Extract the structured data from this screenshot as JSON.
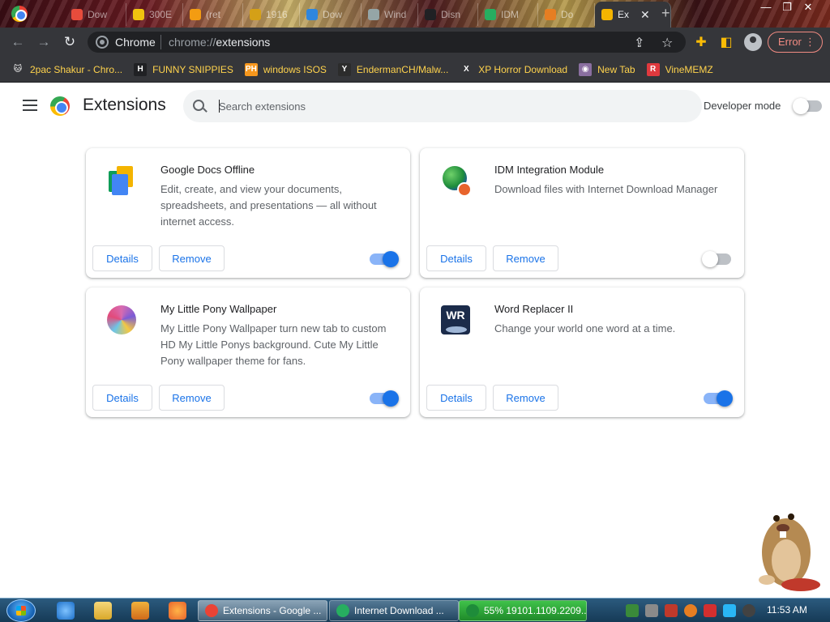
{
  "browser": {
    "tabs": [
      {
        "label": "Dow",
        "color": "#e74c3c"
      },
      {
        "label": "300E",
        "color": "#f1c40f"
      },
      {
        "label": "(ret",
        "color": "#f39c12"
      },
      {
        "label": "1916",
        "color": "#d4a017"
      },
      {
        "label": "Dow",
        "color": "#2e86de"
      },
      {
        "label": "Wind",
        "color": "#95a5a6"
      },
      {
        "label": "Disn",
        "color": "#202124"
      },
      {
        "label": "IDM",
        "color": "#27ae60"
      },
      {
        "label": "Do",
        "color": "#e67e22"
      },
      {
        "label": "Ex",
        "color": "#f4b400"
      }
    ],
    "new_tab": "+",
    "window_controls": {
      "minimize": "—",
      "restore": "❐",
      "close": "✕"
    },
    "omnibox": {
      "site_label": "Chrome",
      "url_scheme": "chrome://",
      "url_host": "extensions"
    },
    "error_button": "Error",
    "bookmarks": [
      {
        "label": "2pac Shakur - Chro...",
        "icon": "🐱",
        "bg": "#35363a"
      },
      {
        "label": "FUNNY SNIPPIES",
        "icon": "H",
        "bg": "#202124"
      },
      {
        "label": "windows ISOS",
        "icon": "PH",
        "bg": "#f7971d"
      },
      {
        "label": "EndermanCH/Malw...",
        "icon": "Y",
        "bg": "#2c2c2c"
      },
      {
        "label": "XP Horror Download",
        "icon": "X",
        "bg": "#35363a"
      },
      {
        "label": "New Tab",
        "icon": "◉",
        "bg": "#8a6fa0"
      },
      {
        "label": "VineMEMZ",
        "icon": "R",
        "bg": "#e0393e"
      }
    ]
  },
  "header": {
    "title": "Extensions",
    "search_placeholder": "Search extensions",
    "developer_mode_label": "Developer mode",
    "developer_mode_on": false
  },
  "extensions": [
    {
      "name": "Google Docs Offline",
      "description": "Edit, create, and view your documents, spreadsheets, and presentations — all without internet access.",
      "details_label": "Details",
      "remove_label": "Remove",
      "enabled": true,
      "icon": "google-docs-icon"
    },
    {
      "name": "IDM Integration Module",
      "description": "Download files with Internet Download Manager",
      "details_label": "Details",
      "remove_label": "Remove",
      "enabled": false,
      "icon": "idm-icon"
    },
    {
      "name": "My Little Pony Wallpaper",
      "description": "My Little Pony Wallpaper turn new tab to custom HD My Little Ponys background. Cute My Little Pony wallpaper theme for fans.",
      "details_label": "Details",
      "remove_label": "Remove",
      "enabled": true,
      "icon": "pony-icon"
    },
    {
      "name": "Word Replacer II",
      "description": "Change your world one word at a time.",
      "details_label": "Details",
      "remove_label": "Remove",
      "enabled": true,
      "icon": "word-replacer-icon",
      "icon_text": "WR"
    }
  ],
  "taskbar": {
    "tasks": [
      {
        "label": "Extensions - Google ...",
        "color": "#ea4335",
        "active": true
      },
      {
        "label": "Internet Download ...",
        "color": "#27ae60",
        "active": false
      },
      {
        "label": "55% 19101.1109.2209....",
        "color": "#1e8c3a",
        "active": false,
        "green": true
      }
    ],
    "clock": "11:53 AM"
  }
}
